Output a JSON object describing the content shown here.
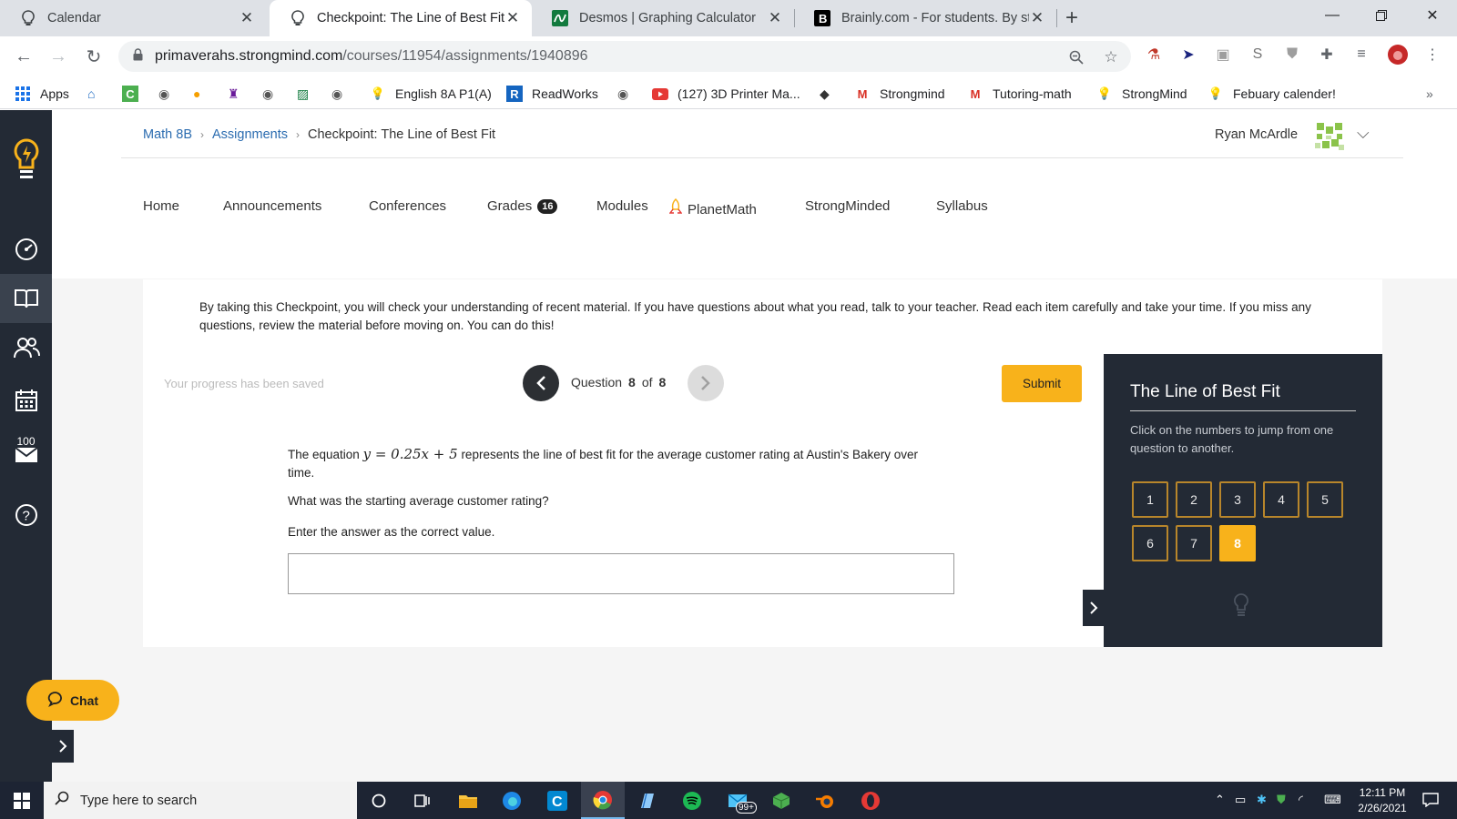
{
  "browser": {
    "tabs": [
      {
        "title": "Calendar",
        "active": false
      },
      {
        "title": "Checkpoint: The Line of Best Fit",
        "active": true
      },
      {
        "title": "Desmos | Graphing Calculator",
        "active": false
      },
      {
        "title": "Brainly.com - For students. By stu",
        "active": false
      }
    ],
    "url_host": "primaverahs.strongmind.com",
    "url_path": "/courses/11954/assignments/1940896",
    "bookmarks": [
      "Apps",
      "English 8A P1(A)",
      "ReadWorks",
      "(127) 3D Printer Ma...",
      "Strongmind",
      "Tutoring-math",
      "StrongMind",
      "Febuary calender!"
    ],
    "bookmarks_more": "»"
  },
  "rail": {
    "badge_count": "100"
  },
  "header": {
    "breadcrumb": [
      "Math 8B",
      "Assignments",
      "Checkpoint: The Line of Best Fit"
    ],
    "user_name": "Ryan McArdle"
  },
  "course_nav": {
    "items": [
      "Home",
      "Announcements",
      "Conferences",
      "Grades",
      "Modules",
      "PlanetMath",
      "StrongMinded",
      "Syllabus"
    ],
    "grades_badge": "16"
  },
  "checkpoint": {
    "intro": "By taking this Checkpoint, you will check your understanding of recent material. If you have questions about what you read, talk to your teacher. Read each item carefully and take your time. If you miss any questions, review the material before moving on. You can do this!",
    "saved_status": "Your progress has been saved",
    "question_label": "Question",
    "question_current": "8",
    "question_of": "of",
    "question_total": "8",
    "submit_label": "Submit",
    "question_prefix": "The equation",
    "equation": "y = 0.25x + 5",
    "question_suffix": "represents the line of best fit for the average customer rating at Austin's Bakery over",
    "question_suffix_2": "time.",
    "prompt": "What was the starting average customer rating?",
    "instruction": "Enter the answer as the correct value.",
    "answer_value": ""
  },
  "panel": {
    "title": "The Line of Best Fit",
    "hint": "Click on the numbers to jump from one question to another.",
    "questions": [
      "1",
      "2",
      "3",
      "4",
      "5",
      "6",
      "7",
      "8"
    ],
    "current": "8"
  },
  "chat": {
    "label": "Chat"
  },
  "taskbar": {
    "search_placeholder": "Type here to search",
    "time": "12:11 PM",
    "date": "2/26/2021",
    "notif_badge": "99+"
  },
  "colors": {
    "accent": "#f8b21b",
    "rail": "#232a35",
    "link": "#2b6cb0"
  }
}
